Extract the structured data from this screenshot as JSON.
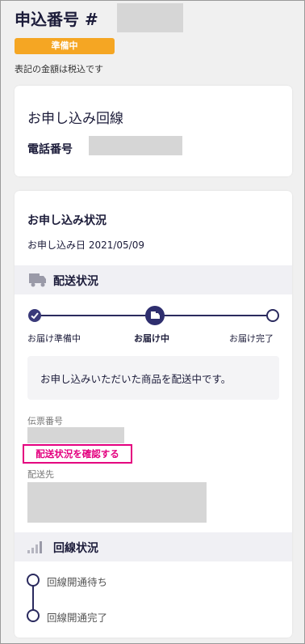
{
  "header": {
    "order_title": "申込番号 #",
    "status_badge": "準備中",
    "tax_note": "表記の金額は税込です"
  },
  "line_card": {
    "title": "お申し込み回線",
    "phone_label": "電話番号"
  },
  "status_card": {
    "title": "お申し込み状況",
    "date": "お申し込み日 2021/05/09",
    "delivery_section": {
      "label": "配送状況",
      "icon": "truck-icon",
      "steps": [
        {
          "label": "お届け準備中",
          "state": "done"
        },
        {
          "label": "お届け中",
          "state": "current"
        },
        {
          "label": "お届け完了",
          "state": "pending"
        }
      ],
      "message": "お申し込みいただいた商品を配送中です。",
      "tracking_label": "伝票番号",
      "check_link": "配送状況を確認する",
      "destination_label": "配送先"
    },
    "line_section": {
      "label": "回線状況",
      "icon": "signal-icon",
      "steps": [
        {
          "label": "回線開通待ち"
        },
        {
          "label": "回線開通完了"
        }
      ]
    }
  },
  "colors": {
    "accent": "#2a2a5e",
    "badge": "#f5a623",
    "link_highlight": "#e4007f"
  }
}
